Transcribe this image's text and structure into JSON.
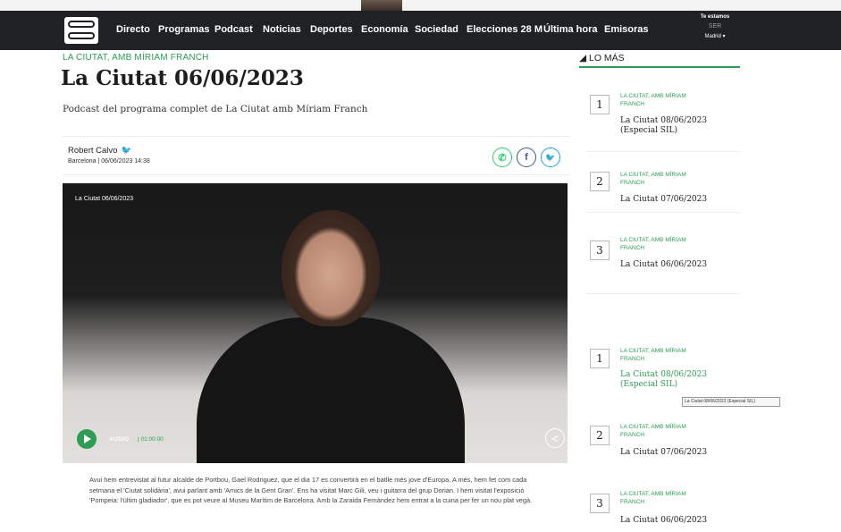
{
  "nav": {
    "items": [
      "Directo",
      "Programas",
      "Podcast",
      "Noticias",
      "Deportes",
      "Economía",
      "Sociedad",
      "Elecciones 28 M",
      "Última hora",
      "Emisoras"
    ],
    "listen_line1": "Te estamos",
    "listen_line2": "SER",
    "listen_line3": "Madrid ▾"
  },
  "article": {
    "program": "LA CIUTAT, AMB MÍRIAM FRANCH",
    "title": "La Ciutat 06/06/2023",
    "subtitle": "Podcast del programa complet de La Ciutat amb Míriam Franch",
    "author": "Robert Calvo",
    "dateline": "Barcelona | 06/06/2023 14:38",
    "body": "Avui hem entrevistat al futur alcalde de Portbou, Gael Rodriguez, que el dia 17 es convertirà en el batlle més jove d'Europa. A més, hem fet com cada setmana el 'Ciutat solidària', avui parlant amb 'Amics de la Gent Gran'. Ens ha visitat Marc Gili, veu i guitarra del grup Dorian. I hem visitat l'exposició 'Pompeia: l'últim gladiador', que es pot veure al Museu Marítim de Barcelona. Amb la Zaraida Fernàndez hem entrat a la cuina per fer un nou plat vegà."
  },
  "player": {
    "label": "La Ciutat 06/06/2023",
    "audio_label": "AUDIO",
    "time": "| 01:00:00"
  },
  "share": {
    "whatsapp_glyph": "✆",
    "facebook_glyph": "f",
    "twitter_glyph": "🐦"
  },
  "sidebar": {
    "heading": "LO MÁS",
    "items": [
      {
        "rank": "1",
        "program": "LA CIUTAT, AMB MÍRIAM FRANCH",
        "title": "La Ciutat 08/06/2023 (Especial SIL)"
      },
      {
        "rank": "2",
        "program": "LA CIUTAT, AMB MÍRIAM FRANCH",
        "title": "La Ciutat 07/06/2023"
      },
      {
        "rank": "3",
        "program": "LA CIUTAT, AMB MÍRIAM FRANCH",
        "title": "La Ciutat 06/06/2023"
      }
    ],
    "items_dup": [
      {
        "rank": "1",
        "program": "LA CIUTAT, AMB MÍRIAM FRANCH",
        "title": "La Ciutat 08/06/2023 (Especial SIL)"
      },
      {
        "rank": "2",
        "program": "LA CIUTAT, AMB MÍRIAM FRANCH",
        "title": "La Ciutat 07/06/2023"
      },
      {
        "rank": "3",
        "program": "LA CIUTAT, AMB MÍRIAM FRANCH",
        "title": "La Ciutat 06/06/2023"
      }
    ],
    "tooltip": "La Ciutat 08/06/2023 (Especial SIL)"
  },
  "colors": {
    "accent": "#2e9c54",
    "nav_bg": "#202124",
    "twitter": "#1da1f2"
  }
}
